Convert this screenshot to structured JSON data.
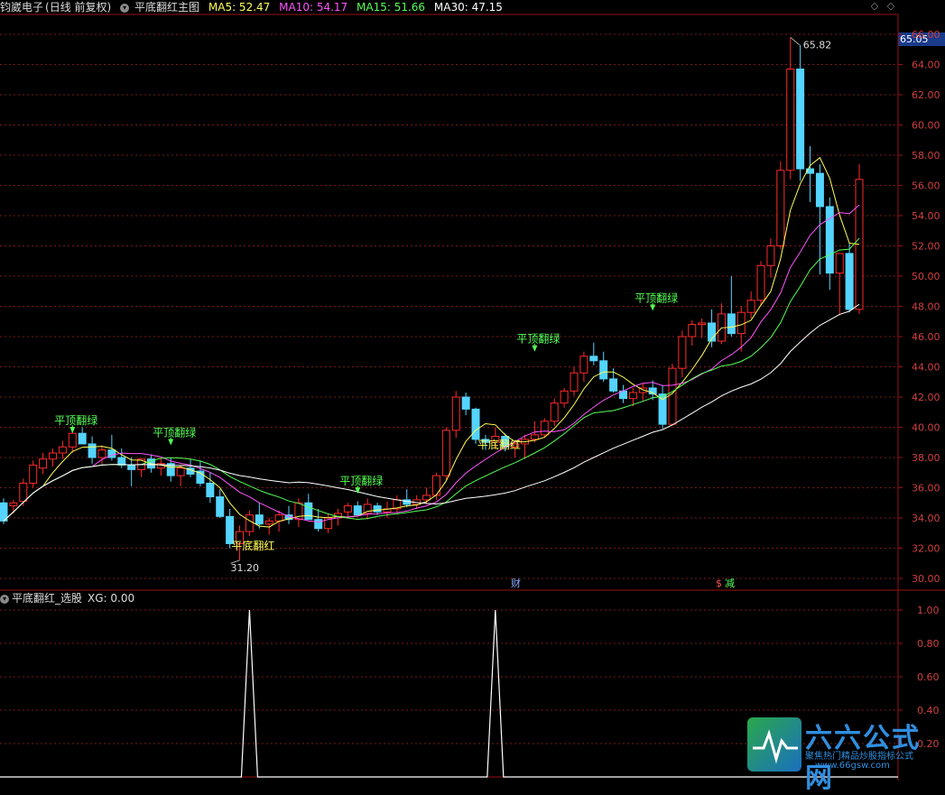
{
  "header": {
    "stock_name": "钧崴电子",
    "period": "(日线 前复权)",
    "indicator_name": "平底翻红主图",
    "ma": [
      {
        "label": "MA5: 52.47",
        "color": "#ffff55"
      },
      {
        "label": "MA10: 54.17",
        "color": "#ff55ff"
      },
      {
        "label": "MA15: 51.66",
        "color": "#55ff55"
      },
      {
        "label": "MA30: 47.15",
        "color": "#ffffff"
      }
    ]
  },
  "sub_header": {
    "indicator_name": "平底翻红_选股",
    "xg_label": "XG: 0.00"
  },
  "current_price": "65.05",
  "max_marker": "65.82",
  "min_marker": "31.20",
  "colors": {
    "up": "#ff2a2a",
    "down": "#54d4ff",
    "grid": "#7a1a1a",
    "axis": "#9a1010"
  },
  "price_axis": [
    "66.00",
    "64.00",
    "62.00",
    "60.00",
    "58.00",
    "56.00",
    "54.00",
    "52.00",
    "50.00",
    "48.00",
    "46.00",
    "44.00",
    "42.00",
    "40.00",
    "38.00",
    "36.00",
    "34.00",
    "32.00",
    "30.00"
  ],
  "sub_axis": [
    "1.00",
    "0.80",
    "0.60",
    "0.40",
    "0.20"
  ],
  "signals": [
    {
      "text": "平顶翻绿",
      "color": "#55ff55"
    },
    {
      "text": "平顶翻绿",
      "color": "#55ff55"
    },
    {
      "text": "平顶翻绿",
      "color": "#55ff55"
    },
    {
      "text": "平顶翻绿",
      "color": "#55ff55"
    },
    {
      "text": "平顶翻绿",
      "color": "#55ff55"
    },
    {
      "text": "平底翻红",
      "color": "#ffff55"
    },
    {
      "text": "平底翻红",
      "color": "#ffff55"
    }
  ],
  "markers": {
    "cai": "财",
    "jian": "减",
    "dollar": "$"
  },
  "logo": {
    "title": "六六公式网",
    "subtitle": "聚焦热门精品炒股指标公式",
    "url": "www.66gsw.com"
  },
  "icons": {
    "diamond": "◇",
    "diamond2": "◇"
  }
}
